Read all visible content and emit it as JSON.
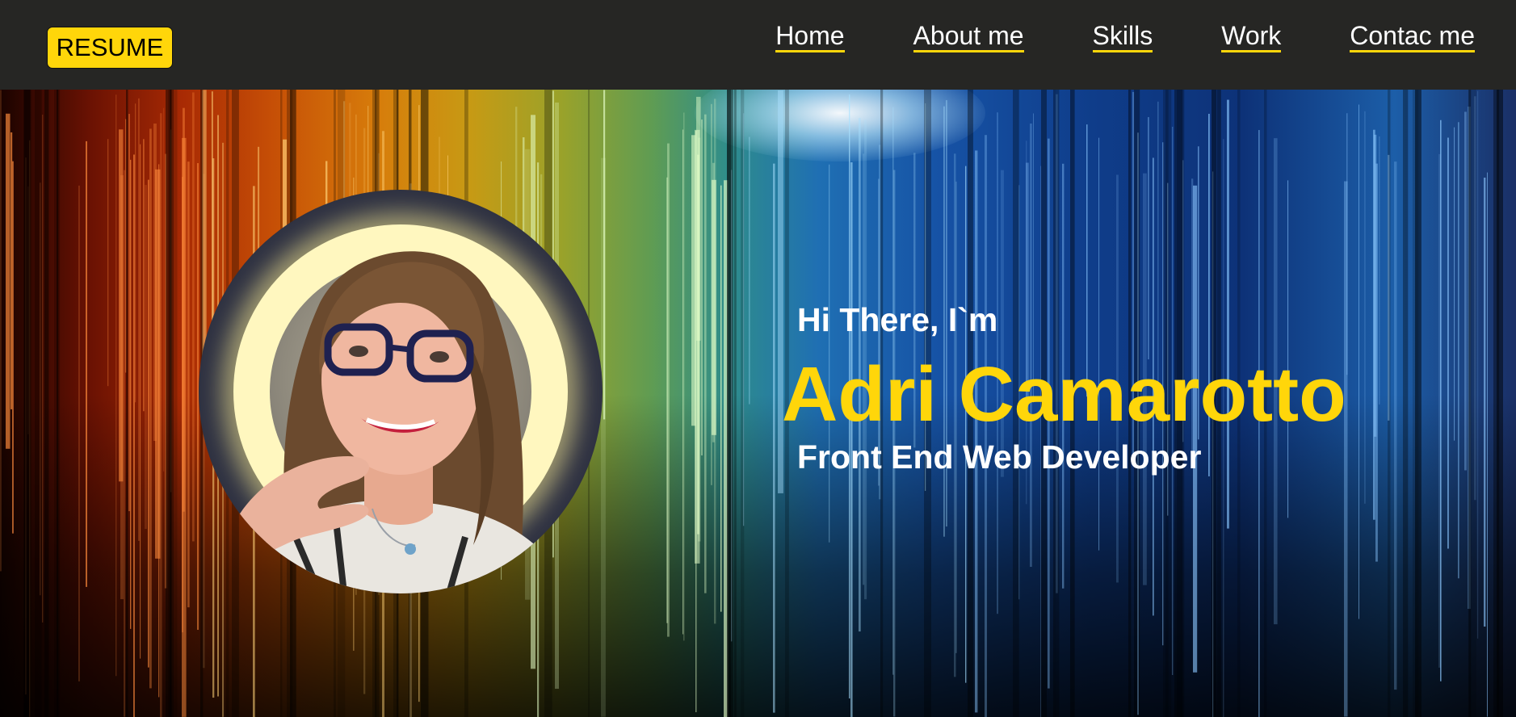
{
  "header": {
    "resume_label": "RESUME",
    "nav": [
      {
        "label": "Home"
      },
      {
        "label": "About me"
      },
      {
        "label": "Skills"
      },
      {
        "label": "Work"
      },
      {
        "label": "Contac me"
      }
    ]
  },
  "hero": {
    "greeting": "Hi There, I`m",
    "name": "Adri Camarotto",
    "role": "Front End Web Developer"
  },
  "icons": {
    "avatar": "profile-photo"
  },
  "colors": {
    "accent": "#ffd60a",
    "nav_background": "#262624",
    "text": "#ffffff"
  }
}
